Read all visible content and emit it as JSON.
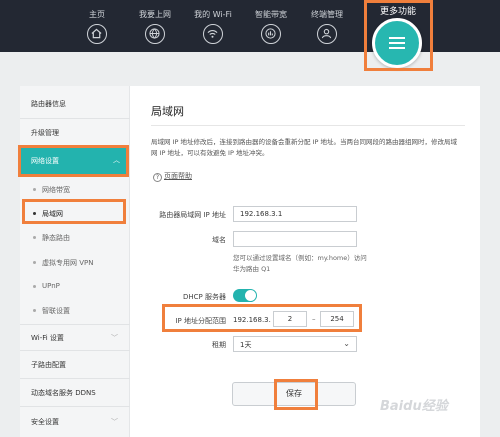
{
  "topnav": {
    "items": [
      {
        "label": "主页",
        "icon": "home-icon"
      },
      {
        "label": "我要上网",
        "icon": "globe-icon"
      },
      {
        "label": "我的 Wi-Fi",
        "icon": "wifi-icon"
      },
      {
        "label": "智能带宽",
        "icon": "bandwidth-icon"
      },
      {
        "label": "终端管理",
        "icon": "user-icon"
      }
    ],
    "more_label": "更多功能",
    "more_icon": "menu-icon"
  },
  "sidebar": {
    "items": [
      "路由器信息",
      "升级管理",
      "网络设置",
      "Wi-Fi 设置",
      "子路由配置",
      "动态域名服务 DDNS",
      "安全设置"
    ],
    "subitems": [
      "网络带宽",
      "局域网",
      "静态路由",
      "虚拟专用网 VPN",
      "UPnP",
      "智联设置"
    ]
  },
  "main": {
    "title": "局域网",
    "description": "局域网 IP 地址修改后，连接到路由器的设备会重新分配 IP 地址。当两台同网段的路由器组网时，修改局域网 IP 地址，可以有效避免 IP 地址冲突。",
    "help_icon": "?",
    "help_link": "页面帮助",
    "fields": {
      "router_ip_label": "路由器局域网 IP 地址",
      "router_ip_value": "192.168.3.1",
      "domain_label": "域名",
      "domain_value": "",
      "domain_hint": "您可以通过设置域名（例如：my.home）访问华为路由 Q1",
      "dhcp_label": "DHCP 服务器",
      "dhcp_on": true,
      "range_label": "IP 地址分配范围",
      "range_prefix": "192.168.3.",
      "range_start": "2",
      "range_sep": "–",
      "range_end": "254",
      "lease_label": "租期",
      "lease_value": "1天"
    },
    "save_label": "保存"
  },
  "watermark": "Baidu经验",
  "colors": {
    "accent": "#23b3ae",
    "highlight": "#f07f3c",
    "nav_bg": "#232833"
  }
}
